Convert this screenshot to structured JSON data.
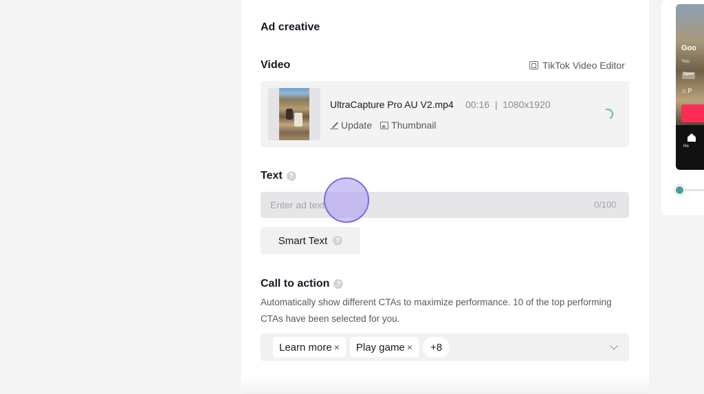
{
  "ad_creative": {
    "title": "Ad creative",
    "video": {
      "label": "Video",
      "editor_link": "TikTok Video Editor",
      "file_name": "UltraCapture Pro AU V2.mp4",
      "duration": "00:16",
      "separator": "|",
      "resolution": "1080x1920",
      "update_label": "Update",
      "thumbnail_label": "Thumbnail"
    },
    "text": {
      "label": "Text",
      "help": "?",
      "placeholder": "Enter ad text",
      "value": "",
      "counter": "0/100",
      "smart_text_label": "Smart Text"
    },
    "call_to_action": {
      "label": "Call to action",
      "help": "?",
      "description": "Automatically show different CTAs to maximize performance. 10 of the top performing CTAs have been selected for you.",
      "tags": [
        {
          "label": "Learn more",
          "remove": "×"
        },
        {
          "label": "Play game",
          "remove": "×"
        }
      ],
      "more_count": "+8"
    }
  },
  "preview": {
    "title_fragment": "Goo",
    "sub_fragment": "You",
    "sponsored_fragment": "Spon",
    "music_fragment": "♫ P",
    "home_label": "Ho",
    "slider_position": 0.0,
    "accent_color": "#fe2c55",
    "slider_color": "#4a9b98"
  },
  "colors": {
    "spinner": "#5fb7b3",
    "cursor_highlight": "#7b6be0"
  },
  "icons": {
    "editor": "video-editor-icon",
    "update": "pencil-icon",
    "thumbnail": "image-icon",
    "loading": "spinner-icon",
    "help": "question-mark-icon",
    "dropdown": "chevron-down-icon"
  }
}
